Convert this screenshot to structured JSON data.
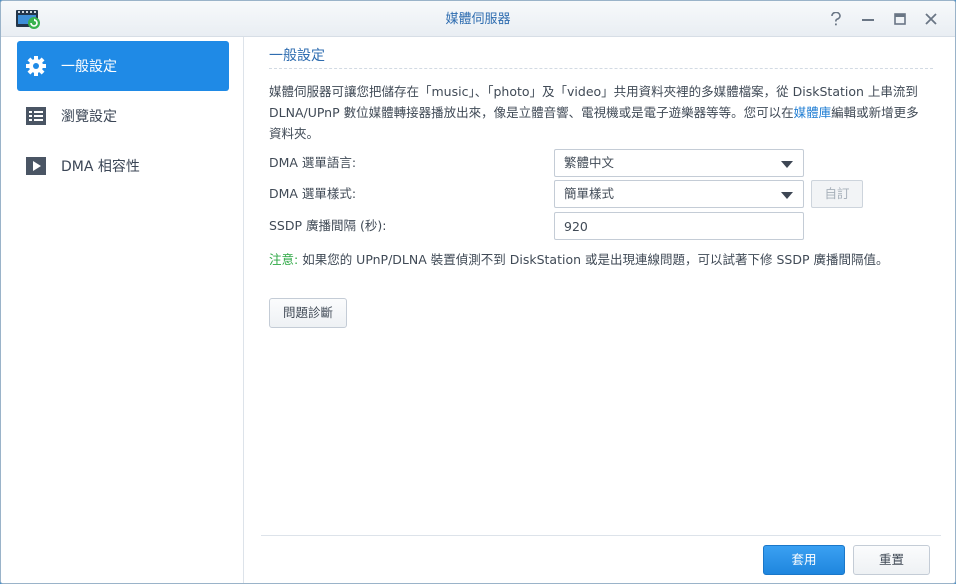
{
  "window": {
    "title": "媒體伺服器",
    "icons": [
      "media-server-app-icon",
      "help-icon",
      "minimize-icon",
      "maximize-icon",
      "close-icon"
    ]
  },
  "sidebar": {
    "items": [
      {
        "label": "一般設定",
        "icon": "gear-icon",
        "active": true
      },
      {
        "label": "瀏覽設定",
        "icon": "list-icon",
        "active": false
      },
      {
        "label": "DMA 相容性",
        "icon": "play-icon",
        "active": false
      }
    ]
  },
  "general": {
    "section_title": "一般設定",
    "description_before": "媒體伺服器可讓您把儲存在「music」、「photo」及「video」共用資料夾裡的多媒體檔案，從 DiskStation 上串流到 DLNA/UPnP 數位媒體轉接器播放出來，像是立體音響、電視機或是電子遊樂器等等。您可以在",
    "description_link": "媒體庫",
    "description_after": "編輯或新增更多資料夾。",
    "dma_language": {
      "label": "DMA 選單語言:",
      "value": "繁體中文"
    },
    "dma_style": {
      "label": "DMA 選單樣式:",
      "value": "簡單樣式",
      "custom_label": "自訂"
    },
    "ssdp": {
      "label": "SSDP 廣播間隔 (秒):",
      "value": "920"
    },
    "note_prefix": "注意:",
    "note_text": " 如果您的 UPnP/DLNA 裝置偵測不到 DiskStation 或是出現連線問題，可以試著下修 SSDP 廣播間隔值。",
    "diagnose_label": "問題診斷"
  },
  "footer": {
    "apply_label": "套用",
    "reset_label": "重置"
  },
  "colors": {
    "accent": "#1f8ae6",
    "title": "#2f6db0",
    "note": "#2ea845",
    "link": "#1f7dd3"
  }
}
